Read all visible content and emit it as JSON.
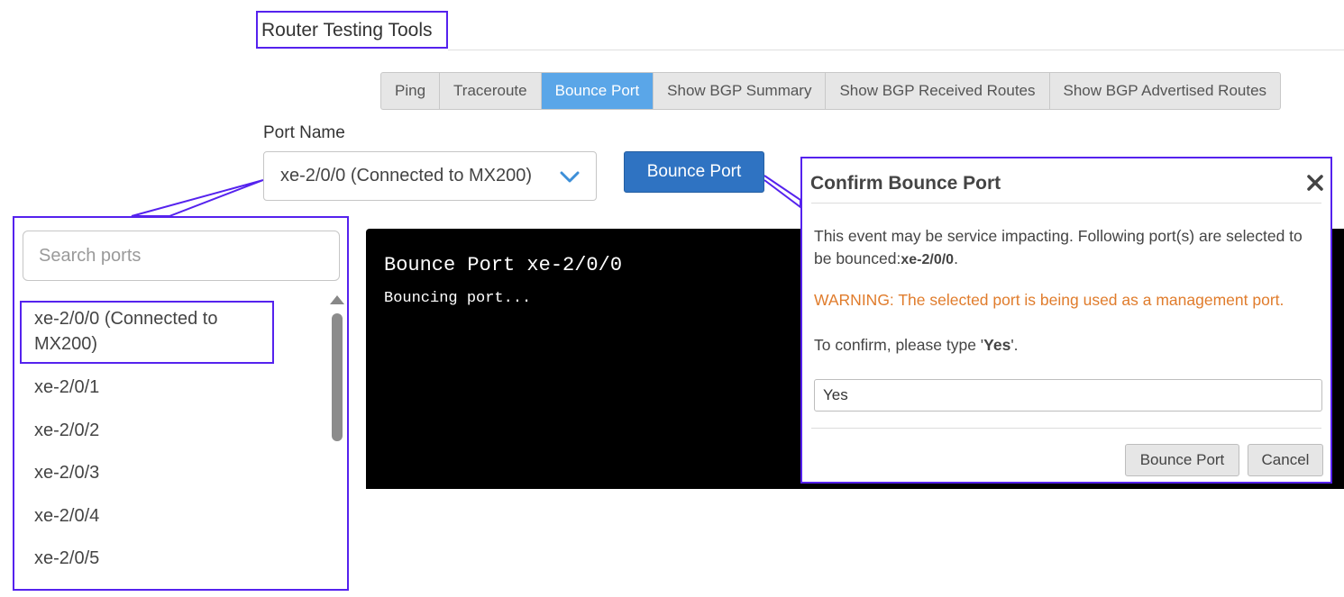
{
  "app": {
    "title": "Router Testing Tools"
  },
  "tabs": [
    {
      "label": "Ping",
      "active": false
    },
    {
      "label": "Traceroute",
      "active": false
    },
    {
      "label": "Bounce Port",
      "active": true
    },
    {
      "label": "Show BGP Summary",
      "active": false
    },
    {
      "label": "Show BGP Received Routes",
      "active": false
    },
    {
      "label": "Show BGP Advertised Routes",
      "active": false
    }
  ],
  "form": {
    "port_label": "Port Name",
    "selected_port": "xe-2/0/0 (Connected to MX200)",
    "bounce_button": "Bounce Port"
  },
  "dropdown": {
    "search_placeholder": "Search ports",
    "items": [
      {
        "label_line1": "xe-2/0/0 (Connected to",
        "label_line2": "MX200)"
      },
      {
        "label": "xe-2/0/1"
      },
      {
        "label": "xe-2/0/2"
      },
      {
        "label": "xe-2/0/3"
      },
      {
        "label": "xe-2/0/4"
      },
      {
        "label": "xe-2/0/5"
      }
    ]
  },
  "terminal": {
    "title": "Bounce Port xe-2/0/0",
    "line": "Bouncing port..."
  },
  "modal": {
    "title": "Confirm Bounce Port",
    "body_prefix": "This event may be service impacting. Following port(s) are selected to be bounced:",
    "body_port": "xe-2/0/0",
    "body_suffix": ".",
    "warning": "WARNING: The selected port is being used as a management port.",
    "confirm_prefix": "To confirm, please type '",
    "confirm_word": "Yes",
    "confirm_suffix": "'.",
    "input_value": "Yes",
    "confirm_button": "Bounce Port",
    "cancel_button": "Cancel"
  },
  "colors": {
    "accent": "#5aa6e8",
    "primary_button": "#2f73c2",
    "warning": "#e07c2c",
    "highlight": "#5522ee"
  },
  "icons": [
    "chevron-down-icon",
    "close-icon",
    "scroll-up-arrow-icon"
  ]
}
